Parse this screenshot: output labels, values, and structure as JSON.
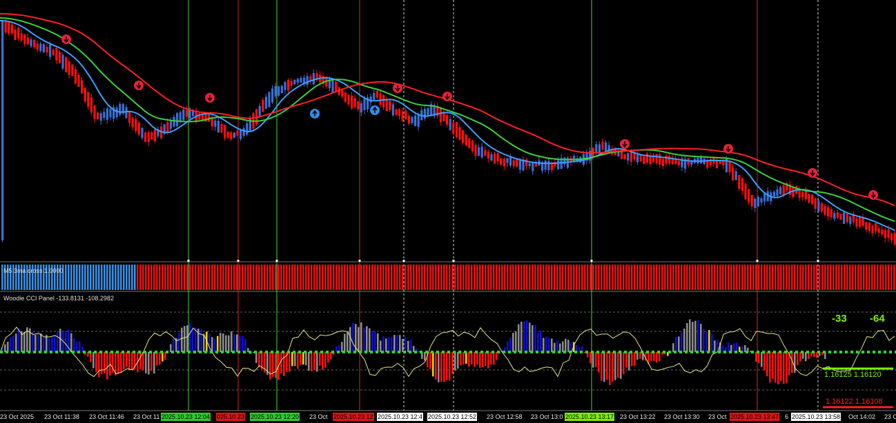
{
  "colors": {
    "bg": "#000000",
    "bull": "#3b6fd6",
    "bear": "#ff1010",
    "ma_fast": "#3aa0ff",
    "ma_mid": "#3ad23a",
    "ma_slow": "#ff2020",
    "green_vline": "#4cd24c",
    "red_vline": "#d42a2a",
    "grid": "#bbbbbb",
    "panel_blue": "#3b8de0",
    "panel_red": "#e01414",
    "cci_red": "#ff1010",
    "cci_gray": "#8c8c8c",
    "cci_blue": "#1010d0",
    "cci_yellow": "#f0d000",
    "cci_line": "#e6e68c",
    "zero_green": "#24e024",
    "value_green": "#7cf000",
    "value_red": "#ff2020"
  },
  "panel_ma": {
    "title": "M5  3ma cross 1.0000"
  },
  "panel_cci": {
    "title": "Woodie CCI Panel -133.8131 -108.2982",
    "value_left": "-33",
    "value_right": "-64",
    "price_green": "1.16125  1.16120",
    "price_red": "1.16122  1.16108"
  },
  "time_axis": {
    "labels": [
      "23 Oct 2025",
      "23 Oct 11:38",
      "23 Oct 11:46",
      "23 Oct 11",
      "23 Oct ",
      "23 Oct 12:58",
      "23 Oct 13:0",
      "23 Oct 13:22",
      "23 Oct 13:30",
      "23 Oct ",
      "Oct 14:02",
      "23 O"
    ],
    "highlights": [
      {
        "text": "2025.10.23 12:04",
        "style": "green"
      },
      {
        "text": "025.10.23",
        "style": "red"
      },
      {
        "text": "2025.10.23 12:20",
        "style": "green"
      },
      {
        "text": "2025.10.23 12",
        "style": "red"
      },
      {
        "text": "2025.10.23 12:4",
        "style": "white"
      },
      {
        "text": "2025.10.23 12:52",
        "style": "white"
      },
      {
        "text": "2025.10.23 13:17",
        "style": "lime"
      },
      {
        "text": "2025.10.23 13:47",
        "style": "red"
      },
      {
        "text": "6",
        "style": "plain"
      },
      {
        "text": "2025.10.23 13:58",
        "style": "white"
      }
    ]
  }
}
